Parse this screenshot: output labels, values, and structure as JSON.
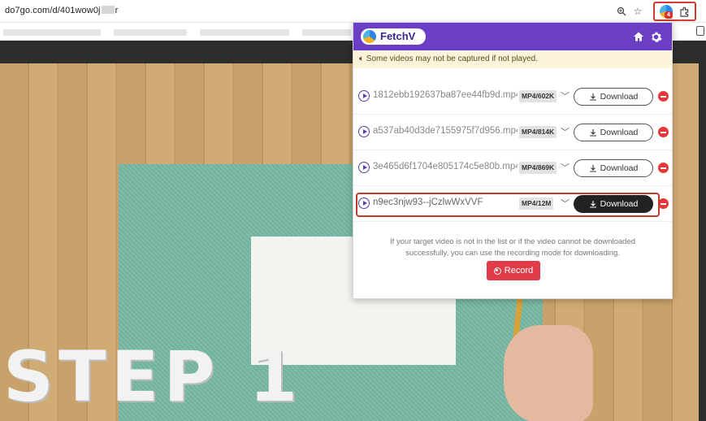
{
  "browser": {
    "url_prefix": "do7go.com/d/401wow0j",
    "url_suffix": "r",
    "extension_badge": "4"
  },
  "video": {
    "overlay_text": "STEP 1"
  },
  "popup": {
    "brand": "FetchV",
    "notice": "Some videos may not be captured if not played.",
    "items": [
      {
        "filename": "1812ebb192637ba87ee44fb9d.mp4",
        "format": "MP4/602K",
        "button": "Download"
      },
      {
        "filename": "a537ab40d3de7155975f7d956.mp4",
        "format": "MP4/814K",
        "button": "Download"
      },
      {
        "filename": "3e465d6f1704e805174c5e80b.mp4",
        "format": "MP4/869K",
        "button": "Download"
      },
      {
        "filename": "n9ec3njw93--jCzlwWxVVF",
        "format": "MP4/12M",
        "button": "Download"
      }
    ],
    "footnote": "If your target video is not in the list or if the video cannot be downloaded successfully, you can use the recording mode for downloading.",
    "record_label": "Record",
    "colors": {
      "header": "#6a3fc6",
      "record": "#e03c48",
      "remove": "#e5383b"
    }
  }
}
